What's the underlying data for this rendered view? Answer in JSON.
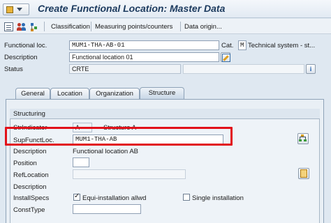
{
  "window": {
    "title": "Create Functional Location: Master Data"
  },
  "toolbar": {
    "classification": "Classification",
    "measuring_points": "Measuring points/counters",
    "data_origin": "Data origin..."
  },
  "header": {
    "functional_loc_label": "Functional loc.",
    "functional_loc_value": "MUM1-THA-AB-01",
    "category_label": "Cat.",
    "category_value": "M",
    "category_text": "Technical system - st...",
    "description_label": "Description",
    "description_value": "Functional location 01",
    "status_label": "Status",
    "status_value": "CRTE"
  },
  "tabs": [
    {
      "label": "General"
    },
    {
      "label": "Location"
    },
    {
      "label": "Organization"
    },
    {
      "label": "Structure"
    }
  ],
  "active_tab": "Structure",
  "structuring": {
    "group_title": "Structuring",
    "str_indicator_label": "StrIndicator",
    "str_indicator_value": "A",
    "str_indicator_text": "Structure A",
    "sup_funct_loc_label": "SupFunctLoc.",
    "sup_funct_loc_value": "MUM1-THA-AB",
    "description_label": "Description",
    "description_text": "Functional location AB",
    "position_label": "Position",
    "position_value": "",
    "ref_location_label": "RefLocation",
    "ref_location_value": "",
    "ref_description_label": "Description",
    "install_specs_label": "InstallSpecs",
    "equi_install_label": "Equi-installation allwd",
    "equi_install_checked": true,
    "single_install_label": "Single installation",
    "single_install_checked": false,
    "const_type_label": "ConstType",
    "const_type_value": ""
  },
  "colors": {
    "highlight_box": "#e2111a",
    "title_text": "#1c3a5e"
  }
}
